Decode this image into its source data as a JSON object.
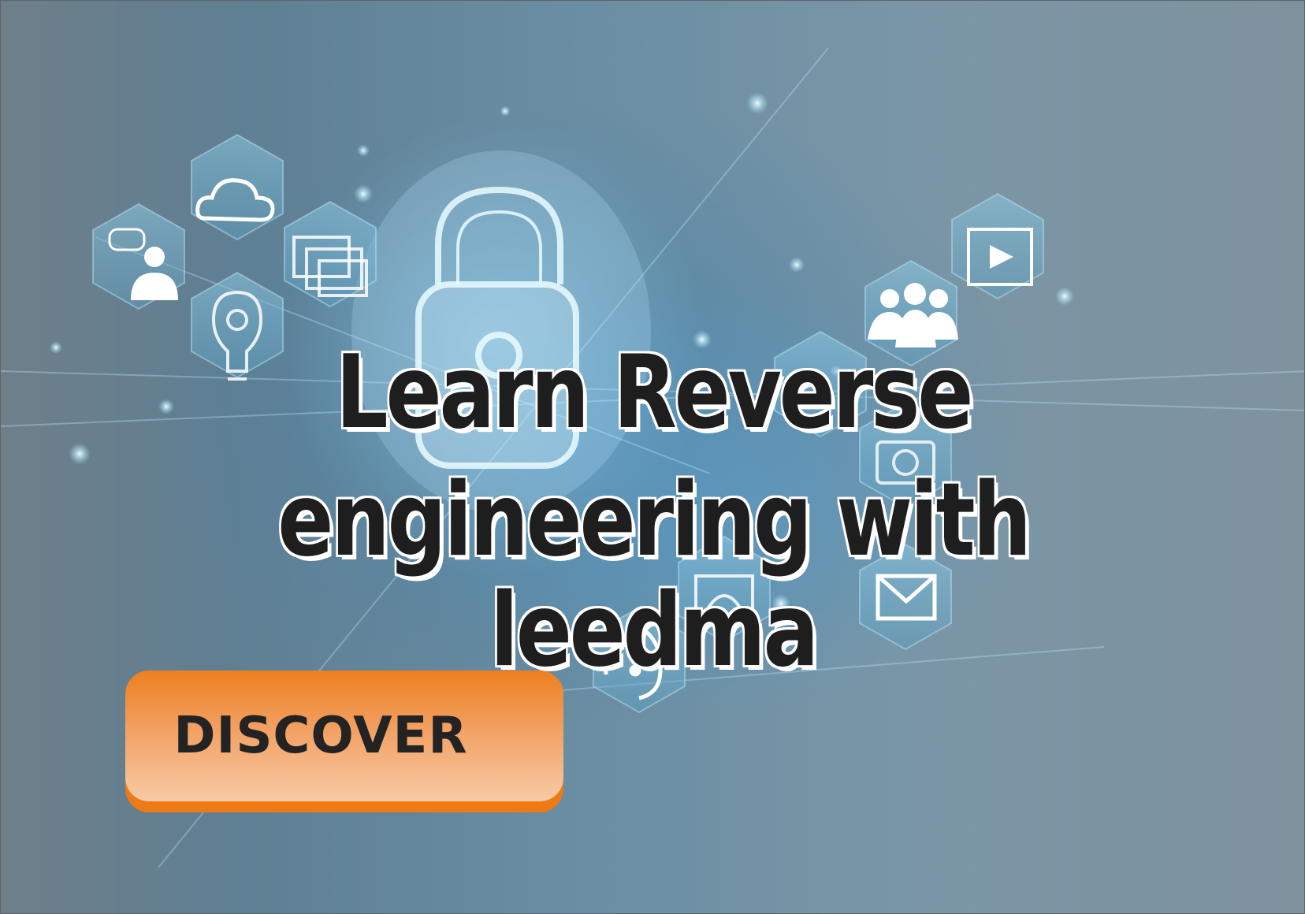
{
  "headline": {
    "line1": "Learn Reverse",
    "line2": "engineering with leedma"
  },
  "cta": {
    "label": "DISCOVER"
  },
  "colors": {
    "cta_top": "#ee7f1f",
    "cta_bottom": "#f7caa6",
    "headline_text": "#1e1e1e",
    "headline_outline": "#ffffff",
    "background": "#7b8d98"
  },
  "icons": [
    "padlock-icon",
    "cloud-icon",
    "chat-user-icon",
    "windows-icon",
    "lightbulb-gear-icon",
    "video-play-icon",
    "group-icon",
    "camera-icon",
    "laptop-settings-icon",
    "mail-icon",
    "phone-wifi-icon"
  ]
}
